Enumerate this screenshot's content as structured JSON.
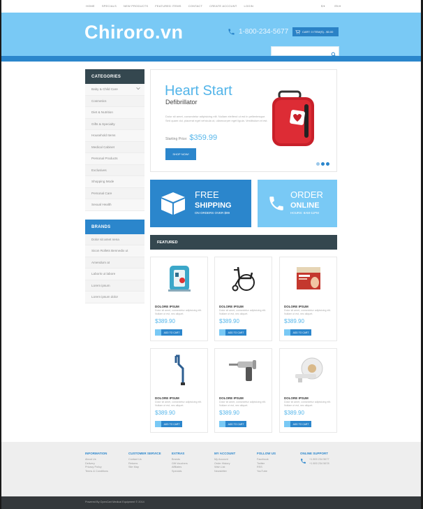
{
  "topnav": {
    "links": [
      "HOME",
      "SPECIALS",
      "NEW PRODUCTS",
      "FEATURED ITEMS",
      "CONTACT",
      "CREATE ACCOUNT",
      "LOGIN"
    ],
    "currency": "$ ▾",
    "language": "EN ▾"
  },
  "header": {
    "logo": "Chiroro.vn",
    "phone": "1-800-234-5677",
    "cart_label": "CART: 0 ITEM(S) - $0.00",
    "search_placeholder": ""
  },
  "sidebar": {
    "categories_title": "CATEGORIES",
    "categories": [
      "Baby & Child Care",
      "Cosmetics",
      "Diet & Nutrition",
      "Gifts & Specialty",
      "Household Items",
      "Medical Cabinet",
      "Personal Products",
      "Exclusives",
      "Shopping Mode",
      "Personal Care",
      "Sexual Health"
    ],
    "brands_title": "BRANDS",
    "brands": [
      "Dolor sit amet nena",
      "Sicon Rollets Bennedix ut",
      "Amendum at",
      "Laboris ut labore",
      "Lorem ipsum",
      "Lorem ipsum dolor"
    ]
  },
  "slider": {
    "title": "Heart Start",
    "subtitle": "Defibrillator",
    "description": "Dolor sit amet, consectetur adipisicing elit. Nullam eleifend ut est in pellentesque. Sed quam dui, placerat eget vehicula ut, ullamcorper eget ligula. Vestibulum et est.",
    "price_label": "Starting Price:",
    "price": "$359.99",
    "button": "SHOP NOW!",
    "dots": 3
  },
  "banners": [
    {
      "line1": "FREE",
      "line2": "SHIPPING",
      "line3": "ON ORDERS OVER $99"
    },
    {
      "line1": "ORDER",
      "line2": "ONLINE",
      "line3": "HOURS: 8AM-11PM"
    }
  ],
  "featured_title": "FEATURED",
  "products": [
    {
      "name": "DOLORE IPSUM",
      "desc": "Dolor sit amet, consectetur adipisicing elit. Nullam ut est, nec aliquet.",
      "price": "$389.90",
      "button": "ADD TO CART",
      "icon": "defibrillator-icon"
    },
    {
      "name": "DOLORE IPSUM",
      "desc": "Dolor sit amet, consectetur adipisicing elit. Nullam ut est, nec aliquet.",
      "price": "$389.90",
      "button": "ADD TO CART",
      "icon": "wheelchair-icon"
    },
    {
      "name": "DOLORE IPSUM",
      "desc": "Dolor sit amet, consectetur adipisicing elit. Nullam ut est, nec aliquet.",
      "price": "$389.90",
      "button": "ADD TO CART",
      "icon": "medicine-box-icon"
    },
    {
      "name": "DOLORE IPSUM",
      "desc": "Dolor sit amet, consectetur adipisicing elit. Nullam ut est, nec aliquet.",
      "price": "$389.90",
      "button": "ADD TO CART",
      "icon": "cane-icon"
    },
    {
      "name": "DOLORE IPSUM",
      "desc": "Dolor sit amet, consectetur adipisicing elit. Nullam ut est, nec aliquet.",
      "price": "$389.90",
      "button": "ADD TO CART",
      "icon": "surgical-drill-icon"
    },
    {
      "name": "DOLORE IPSUM",
      "desc": "Dolor sit amet, consectetur adipisicing elit. Nullam ut est, nec aliquet.",
      "price": "$389.90",
      "button": "ADD TO CART",
      "icon": "mri-scanner-icon"
    }
  ],
  "footer": {
    "columns": [
      {
        "title": "INFORMATION",
        "items": [
          "About Us",
          "Delivery",
          "Privacy Policy",
          "Terms & Conditions"
        ]
      },
      {
        "title": "CUSTOMER SERVICE",
        "items": [
          "Contact Us",
          "Returns",
          "Site Map"
        ]
      },
      {
        "title": "EXTRAS",
        "items": [
          "Brands",
          "Gift Vouchers",
          "Affiliates",
          "Specials"
        ]
      },
      {
        "title": "MY ACCOUNT",
        "items": [
          "My Account",
          "Order History",
          "Wish List",
          "Newsletter"
        ]
      },
      {
        "title": "FOLLOW US",
        "items": [
          "Facebook",
          "Twitter",
          "RSS",
          "YouTube"
        ]
      },
      {
        "title": "ONLINE SUPPORT",
        "items": [
          "+1 800 234 5677",
          "+1 800 234 5678"
        ]
      }
    ],
    "copyright": "Powered By OpenCart Medical Equipment © 2014"
  },
  "colors": {
    "accent": "#2b86cc",
    "light_accent": "#79c9f5",
    "dark": "#34474f"
  }
}
